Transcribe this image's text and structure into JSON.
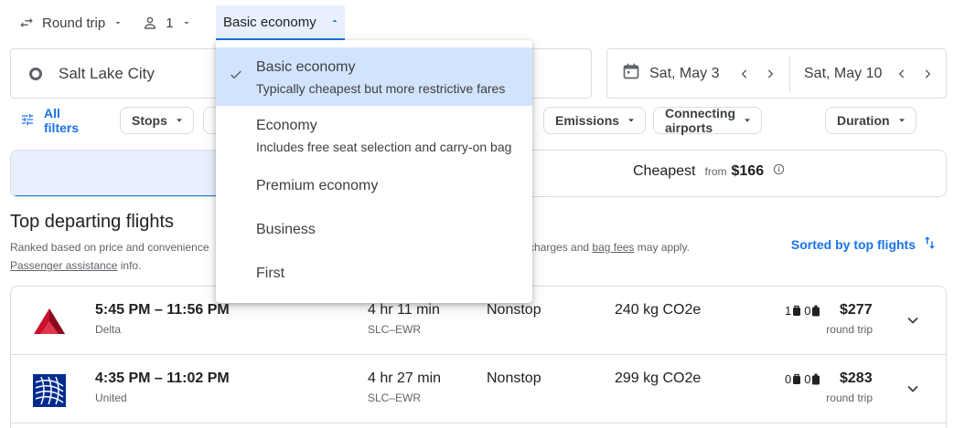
{
  "colors": {
    "accent": "#1a73e8",
    "selected_bg": "#d2e3fc",
    "delta_red": "#c8102e",
    "united_blue": "#002b8f"
  },
  "top_bar": {
    "trip_type": "Round trip",
    "passengers": "1",
    "seat_class": "Basic economy",
    "icons": [
      "swap-icon",
      "person-icon",
      "chevron-down-icon",
      "caret-up-icon"
    ]
  },
  "search": {
    "origin": "Salt Lake City",
    "depart_date": "Sat, May 3",
    "return_date": "Sat, May 10"
  },
  "filters": {
    "all_filters": "All filters",
    "chips": [
      "Stops",
      "Emissions",
      "Connecting airports",
      "Duration"
    ]
  },
  "tabs": {
    "cheapest_label": "Cheapest",
    "cheapest_from": "from",
    "cheapest_price": "$166"
  },
  "results": {
    "title": "Top departing flights",
    "subtitle_start": "Ranked based on price and convenience",
    "subtitle_end_pre": "l charges and",
    "bag_fees_link": "bag fees",
    "subtitle_end_post": "may apply.",
    "assistance_link": "Passenger assistance",
    "assistance_post": "info.",
    "sort_label": "Sorted by top flights",
    "flights": [
      {
        "times": "5:45 PM – 11:56 PM",
        "airline": "Delta",
        "duration": "4 hr 11 min",
        "route": "SLC–EWR",
        "stops": "Nonstop",
        "emissions": "240 kg CO2e",
        "carry_on": "1",
        "checked": "0",
        "price": "$277",
        "price_type": "round trip"
      },
      {
        "times": "4:35 PM – 11:02 PM",
        "airline": "United",
        "duration": "4 hr 27 min",
        "route": "SLC–EWR",
        "stops": "Nonstop",
        "emissions": "299 kg CO2e",
        "carry_on": "0",
        "checked": "0",
        "price": "$283",
        "price_type": "round trip"
      }
    ]
  },
  "class_menu": {
    "options": [
      {
        "label": "Basic economy",
        "description": "Typically cheapest but more restrictive fares",
        "selected": true
      },
      {
        "label": "Economy",
        "description": "Includes free seat selection and carry-on bag",
        "selected": false
      },
      {
        "label": "Premium economy",
        "description": "",
        "selected": false
      },
      {
        "label": "Business",
        "description": "",
        "selected": false
      },
      {
        "label": "First",
        "description": "",
        "selected": false
      }
    ]
  }
}
